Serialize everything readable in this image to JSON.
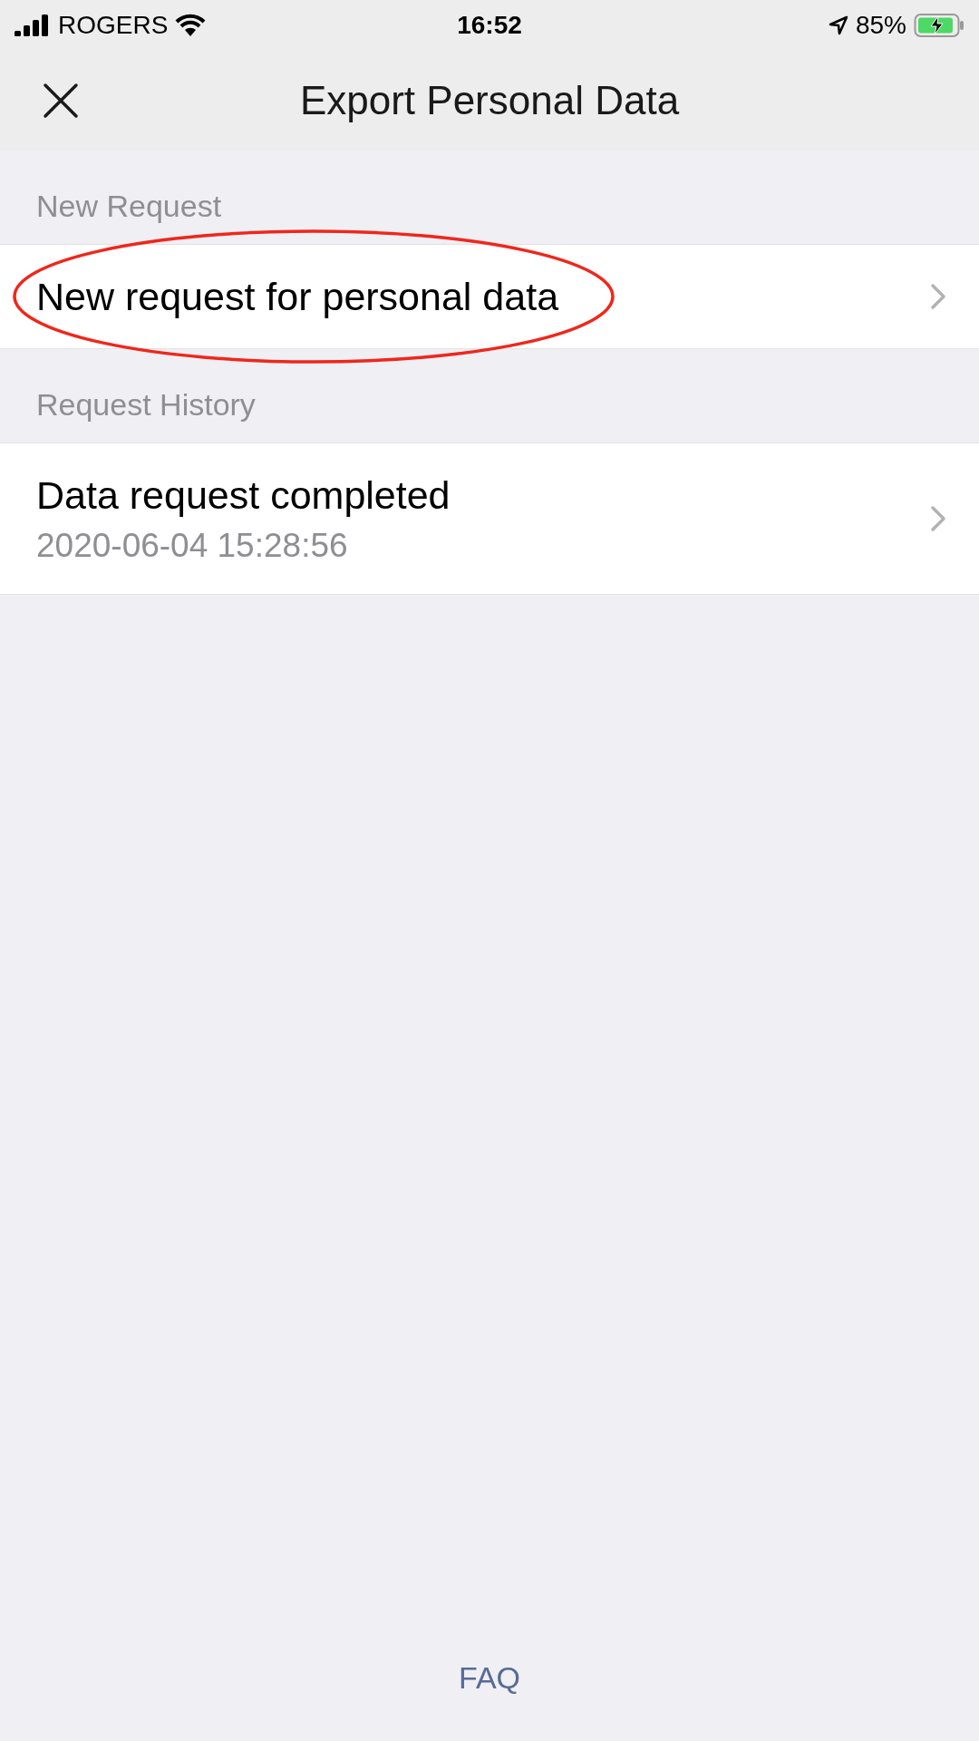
{
  "status_bar": {
    "carrier": "ROGERS",
    "time": "16:52",
    "battery": "85%",
    "charging": true
  },
  "nav": {
    "title": "Export Personal Data"
  },
  "sections": [
    {
      "header": "New Request",
      "rows": [
        {
          "title": "New request for personal data",
          "circled": true
        }
      ]
    },
    {
      "header": "Request History",
      "rows": [
        {
          "title": "Data request completed",
          "subtitle": "2020-06-04 15:28:56",
          "circled": false
        }
      ]
    }
  ],
  "footer_link": "FAQ"
}
